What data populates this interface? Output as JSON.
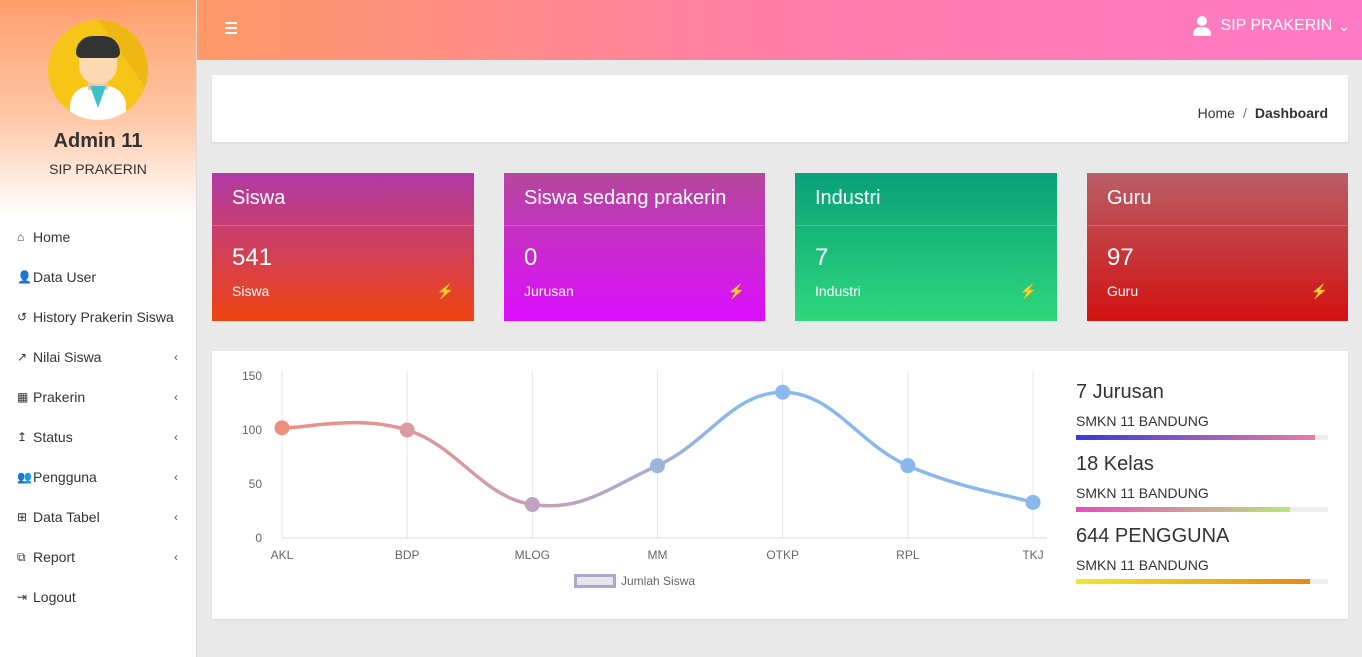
{
  "sidebar": {
    "admin_name": "Admin 11",
    "admin_subtitle": "SIP PRAKERIN",
    "items": [
      {
        "label": "Home",
        "icon": "home-icon",
        "glyph": "⌂",
        "has_children": false
      },
      {
        "label": "Data User",
        "icon": "user-icon",
        "glyph": "👤",
        "has_children": false
      },
      {
        "label": "History Prakerin Siswa",
        "icon": "history-icon",
        "glyph": "↺",
        "has_children": false
      },
      {
        "label": "Nilai Siswa",
        "icon": "line-chart-icon",
        "glyph": "↗",
        "has_children": true
      },
      {
        "label": "Prakerin",
        "icon": "building-icon",
        "glyph": "▦",
        "has_children": true
      },
      {
        "label": "Status",
        "icon": "level-up-icon",
        "glyph": "↥",
        "has_children": true
      },
      {
        "label": "Pengguna",
        "icon": "users-icon",
        "glyph": "👥",
        "has_children": true
      },
      {
        "label": "Data Tabel",
        "icon": "table-icon",
        "glyph": "⊞",
        "has_children": true
      },
      {
        "label": "Report",
        "icon": "report-icon",
        "glyph": "⧉",
        "has_children": true
      },
      {
        "label": "Logout",
        "icon": "sign-out-icon",
        "glyph": "⇥",
        "has_children": false
      }
    ],
    "chevron": "‹"
  },
  "topbar": {
    "user_label": "SIP PRAKERIN",
    "caret": "⌄"
  },
  "breadcrumb": {
    "home": "Home",
    "separator": "/",
    "current": "Dashboard"
  },
  "cards": [
    {
      "title": "Siswa",
      "value": "541",
      "label": "Siswa",
      "icon": "⚡"
    },
    {
      "title": "Siswa sedang prakerin",
      "value": "0",
      "label": "Jurusan",
      "icon": "⚡"
    },
    {
      "title": "Industri",
      "value": "7",
      "label": "Industri",
      "icon": "⚡"
    },
    {
      "title": "Guru",
      "value": "97",
      "label": "Guru",
      "icon": "⚡"
    }
  ],
  "chart_data": {
    "type": "line",
    "categories": [
      "AKL",
      "BDP",
      "MLOG",
      "MM",
      "OTKP",
      "RPL",
      "TKJ"
    ],
    "series": [
      {
        "name": "Jumlah Siswa",
        "values": [
          102,
          100,
          31,
          67,
          135,
          67,
          33
        ]
      }
    ],
    "yticks": [
      "150",
      "100",
      "50",
      "0"
    ],
    "ylim": [
      0,
      150
    ],
    "grid": true,
    "legend_position": "bottom",
    "point_colors": [
      "#ef8f7f",
      "#d99aa3",
      "#bea3c3",
      "#9db4dc",
      "#89b7ee",
      "#88b8ee",
      "#88b8ee"
    ]
  },
  "stats": [
    {
      "big": "7 Jurusan",
      "small": "SMKN 11 BANDUNG",
      "progress": 0.95,
      "gradient": [
        "#3a3ad6",
        "#e97aa6"
      ]
    },
    {
      "big": "18 Kelas",
      "small": "SMKN 11 BANDUNG",
      "progress": 0.85,
      "gradient": [
        "#e84bbf",
        "#b7e87a"
      ]
    },
    {
      "big": "644 PENGGUNA",
      "small": "SMKN 11 BANDUNG",
      "progress": 0.93,
      "gradient": [
        "#f5e62c",
        "#e08a12"
      ]
    }
  ]
}
